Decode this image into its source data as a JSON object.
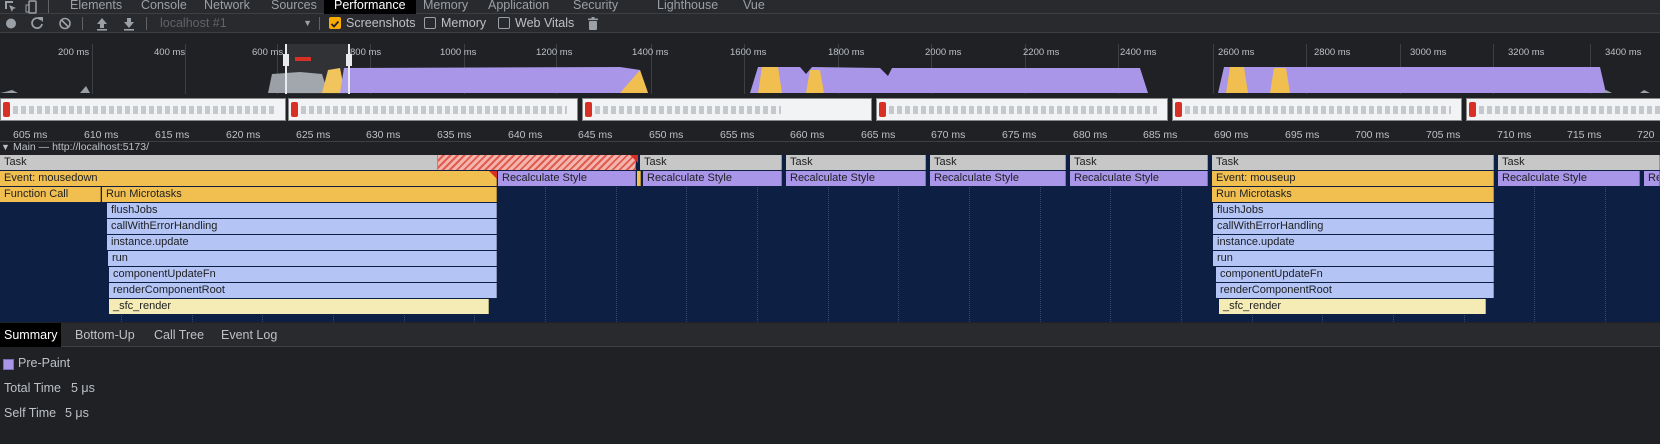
{
  "tabs": [
    "Elements",
    "Console",
    "Network",
    "Sources",
    "Performance",
    "Memory",
    "Application",
    "Security",
    "Lighthouse",
    "Vue"
  ],
  "active_tab": "Performance",
  "toolbar": {
    "context": "localhost #1",
    "screenshots_label": "Screenshots",
    "memory_label": "Memory",
    "webvitals_label": "Web Vitals",
    "screenshots_checked": true,
    "memory_checked": false,
    "webvitals_checked": false
  },
  "overview_ticks": [
    "200 ms",
    "400 ms",
    "600 ms",
    "800 ms",
    "1000 ms",
    "1200 ms",
    "1400 ms",
    "1600 ms",
    "1800 ms",
    "2000 ms",
    "2200 ms",
    "2400 ms",
    "2600 ms",
    "2800 ms",
    "3000 ms",
    "3200 ms",
    "3400 ms"
  ],
  "ruler_ticks": [
    "605 ms",
    "610 ms",
    "615 ms",
    "620 ms",
    "625 ms",
    "630 ms",
    "635 ms",
    "640 ms",
    "645 ms",
    "650 ms",
    "655 ms",
    "660 ms",
    "665 ms",
    "670 ms",
    "675 ms",
    "680 ms",
    "685 ms",
    "690 ms",
    "695 ms",
    "700 ms",
    "705 ms",
    "710 ms",
    "715 ms",
    "720"
  ],
  "main_header": "Main — http://localhost:5173/",
  "flame": {
    "task": "Task",
    "mousedown": "Event: mousedown",
    "mouseup": "Event: mouseup",
    "function_call": "Function Call",
    "run_microtasks": "Run Microtasks",
    "recalc": "Recalculate Style",
    "recalc_short": "Re",
    "flushJobs": "flushJobs",
    "callWithErrorHandling": "callWithErrorHandling",
    "instance_update": "instance.update",
    "run": "run",
    "componentUpdateFn": "componentUpdateFn",
    "renderComponentRoot": "renderComponentRoot",
    "sfc_render": "_sfc_render"
  },
  "bottom_tabs": [
    "Summary",
    "Bottom-Up",
    "Call Tree",
    "Event Log"
  ],
  "active_bottom_tab": "Summary",
  "summary": {
    "title": "Pre-Paint",
    "color": "#a996e8",
    "total_time_label": "Total Time",
    "total_time": "5 μs",
    "self_time_label": "Self Time",
    "self_time": "5 μs"
  }
}
